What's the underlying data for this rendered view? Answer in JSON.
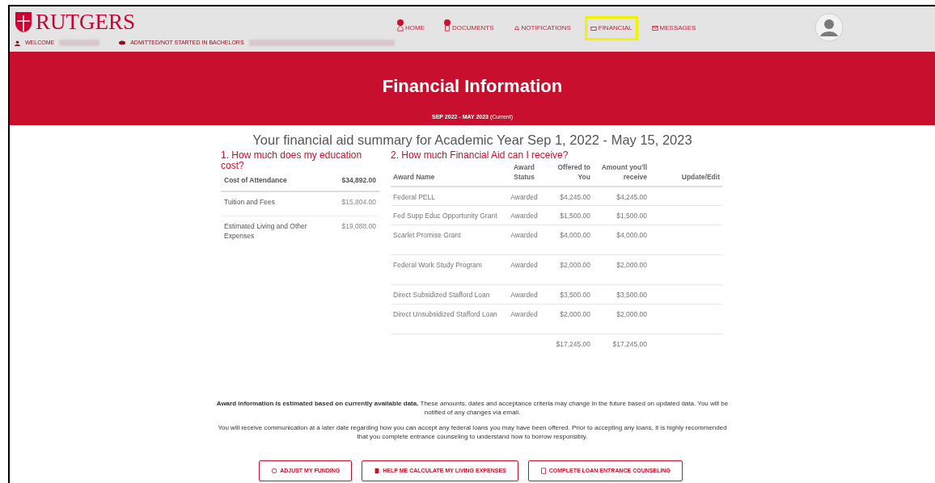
{
  "header": {
    "logo_text": "RUTGERS",
    "welcome": "WELCOME",
    "program_status": "ADMITTED/NOT STARTED IN BACHELORS",
    "nav": [
      {
        "label": "HOME",
        "badge": true,
        "highlighted": false
      },
      {
        "label": "DOCUMENTS",
        "badge": true,
        "highlighted": false
      },
      {
        "label": "NOTIFICATIONS",
        "badge": false,
        "highlighted": false
      },
      {
        "label": "FINANCIAL",
        "badge": false,
        "highlighted": true
      },
      {
        "label": "MESSAGES",
        "badge": false,
        "highlighted": false
      }
    ]
  },
  "page_title": "Financial Information",
  "tabs": [
    {
      "label": "SEP 2022 - MAY 2023",
      "note": "(Current)",
      "selected": true
    }
  ],
  "summary_title": "Your financial aid summary for Academic Year Sep 1, 2022 - May 15, 2023",
  "cost": {
    "heading": "1. How much does my education cost?",
    "total_label": "Cost of Attendance",
    "total_value": "$34,892.00",
    "rows": [
      {
        "label": "Tuition and Fees",
        "value": "$15,804.00"
      },
      {
        "label": "Estimated Living and Other Expenses",
        "value": "$19,088.00"
      }
    ]
  },
  "aid": {
    "heading": "2. How much Financial Aid can I receive?",
    "columns": [
      "Award Name",
      "Award Status",
      "Offered to You",
      "Amount you'll receive",
      "Update/Edit"
    ],
    "rows": [
      {
        "name": "Federal PELL",
        "status": "Awarded",
        "offered": "$4,245.00",
        "receive": "$4,245.00"
      },
      {
        "name": "Fed Supp Educ Opportunity Grant",
        "status": "Awarded",
        "offered": "$1,500.00",
        "receive": "$1,500.00"
      },
      {
        "name": "Scarlet Promise Grant",
        "status": "Awarded",
        "offered": "$4,000.00",
        "receive": "$4,000.00"
      },
      {
        "name": "Federal Work Study Program",
        "status": "Awarded",
        "offered": "$2,000.00",
        "receive": "$2,000.00"
      },
      {
        "name": "Direct Subsidized Stafford Loan",
        "status": "Awarded",
        "offered": "$3,500.00",
        "receive": "$3,500.00"
      },
      {
        "name": "Direct Unsubsidized Stafford Loan",
        "status": "Awarded",
        "offered": "$2,000.00",
        "receive": "$2,000.00"
      }
    ],
    "total_offered": "$17,245.00",
    "total_receive": "$17,245.00"
  },
  "notices": [
    "**Award information is estimated based on currently available data.** These amounts, dates and acceptance criteria may change in the future based on updated data. You will be notified of any changes via email.",
    "You will receive communication at a later date regarding how you can accept any federal loans you may have been offered. Prior to accepting any loans, it is highly recommended that you complete entrance counseling to understand how to borrow responsibly."
  ],
  "buttons": [
    {
      "label": "ADJUST MY FUNDING"
    },
    {
      "label": "HELP ME CALCULATE MY LIVING EXPENSES"
    },
    {
      "label": "COMPLETE LOAN ENTRANCE COUNSELING"
    }
  ]
}
